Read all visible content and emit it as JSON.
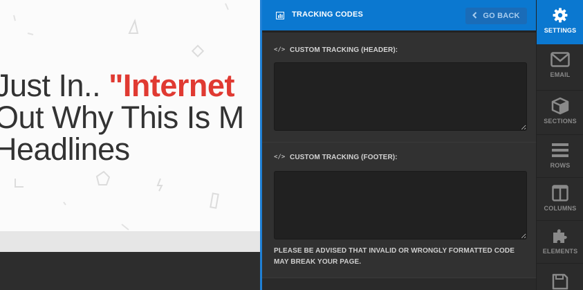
{
  "canvas": {
    "headline_line1_a": "Just In.. ",
    "headline_line1_b": "\"Internet",
    "headline_line2": "Out Why This Is M",
    "headline_line3": "Headlines"
  },
  "panel": {
    "title": "TRACKING CODES",
    "title_icon": "chart-icon",
    "go_back_label": "GO BACK",
    "header_section_label": "CUSTOM TRACKING (HEADER):",
    "header_code_value": "",
    "footer_section_label": "CUSTOM TRACKING (FOOTER):",
    "footer_code_value": "",
    "code_icon": "</>",
    "warning_text": "PLEASE BE ADVISED THAT INVALID OR WRONGLY FORMATTED CODE MAY BREAK YOUR PAGE."
  },
  "rail": {
    "items": [
      {
        "label": "SETTINGS",
        "icon": "gear-icon",
        "active": true
      },
      {
        "label": "EMAIL",
        "icon": "envelope-icon",
        "active": false
      },
      {
        "label": "SECTIONS",
        "icon": "cube-icon",
        "active": false
      },
      {
        "label": "ROWS",
        "icon": "rows-icon",
        "active": false
      },
      {
        "label": "COLUMNS",
        "icon": "columns-icon",
        "active": false
      },
      {
        "label": "ELEMENTS",
        "icon": "puzzle-icon",
        "active": false
      },
      {
        "label": "",
        "icon": "save-icon",
        "active": false
      }
    ]
  },
  "colors": {
    "accent": "#0b78d0",
    "headline_red": "#e03a32",
    "panel_bg": "#313131"
  }
}
